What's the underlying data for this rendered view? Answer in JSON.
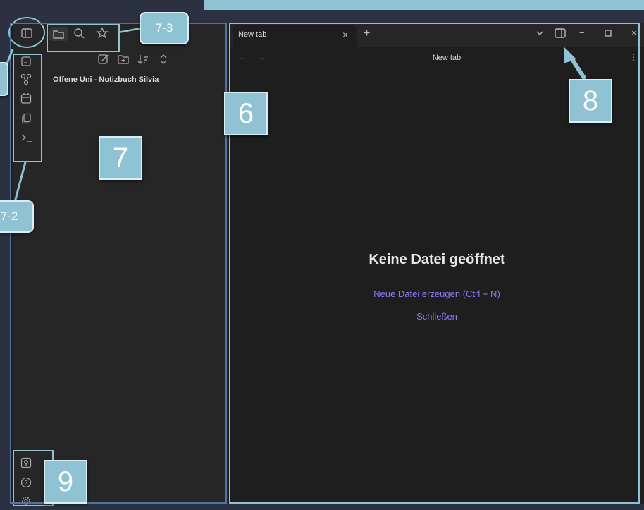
{
  "colors": {
    "background": "#2b3140",
    "app_bg": "#1e1e1e",
    "sidebar_bg": "#262626",
    "accent_link": "#8b7cf6",
    "callout": "#8fc3d3"
  },
  "sidebar_top": {
    "icons": [
      "sidebar-toggle-icon",
      "folder-icon",
      "search-icon",
      "star-icon"
    ]
  },
  "file_toolbar": {
    "icons": [
      "new-note-icon",
      "new-folder-icon",
      "sort-icon",
      "collapse-icon"
    ]
  },
  "ribbon": {
    "top_icons": [
      "graph-icon",
      "canvas-icon",
      "calendar-icon",
      "copy-icon",
      "terminal-icon"
    ],
    "bottom_icons": [
      "vault-icon",
      "help-icon",
      "settings-icon"
    ]
  },
  "file_explorer": {
    "vault_name": "Offene Uni - Notizbuch Silvia"
  },
  "tabs": {
    "active_title": "New tab",
    "close_symbol": "×",
    "new_tab_symbol": "+"
  },
  "navigation": {
    "back": "←",
    "forward": "→",
    "title": "New tab",
    "more": "⋮"
  },
  "window_controls": {
    "chevron": "⌄",
    "minimize": "−",
    "maximize": "□",
    "close": "×"
  },
  "empty_state": {
    "title": "Keine Datei geöffnet",
    "create_link": "Neue Datei erzeugen (Ctrl + N)",
    "close_link": "Schließen"
  },
  "annotations": {
    "a6": "6",
    "a7": "7",
    "a8": "8",
    "a9": "9",
    "a7_2": "7-2",
    "a7_3": "7-3"
  }
}
